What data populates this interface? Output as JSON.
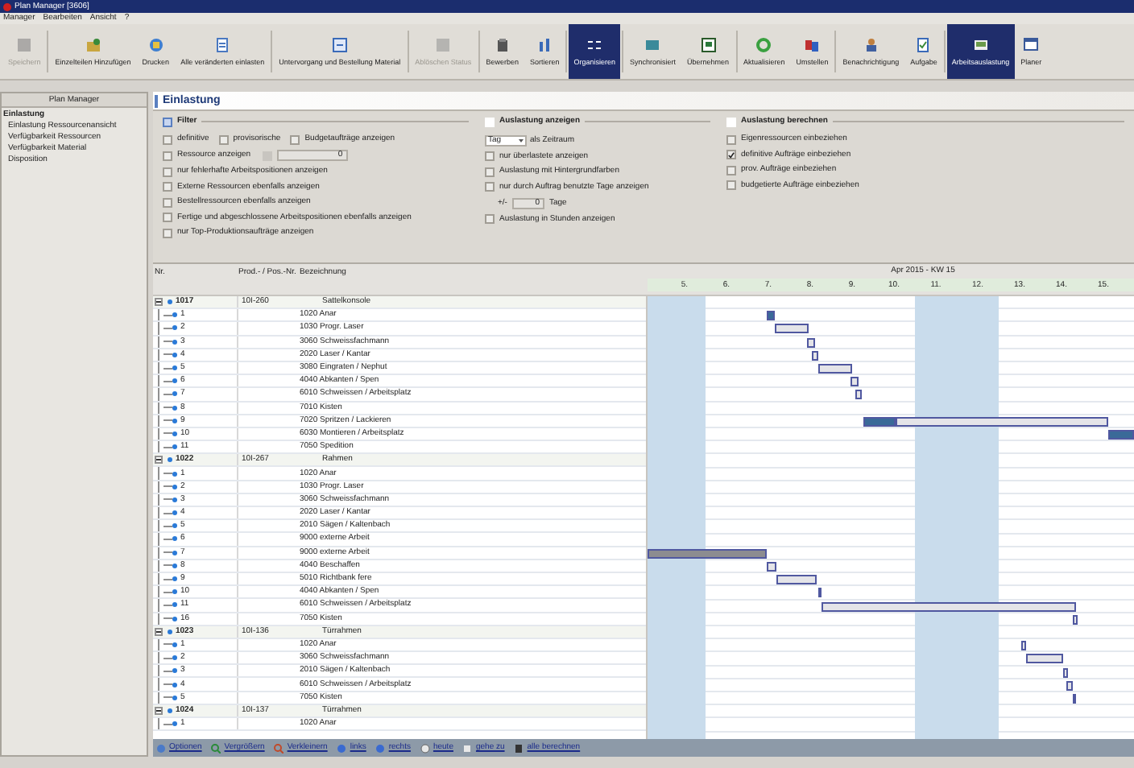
{
  "window": {
    "title": "Plan Manager [3606]"
  },
  "menu": [
    "Manager",
    "Bearbeiten",
    "Ansicht",
    "?"
  ],
  "toolbar": [
    {
      "label": "Speichern",
      "disabled": true,
      "selected": false
    },
    {
      "label": "Einzelteilen Hinzufügen",
      "disabled": false,
      "selected": false
    },
    {
      "label": "Drucken",
      "disabled": false,
      "selected": false
    },
    {
      "label": "Alle veränderten einlasten",
      "disabled": false,
      "selected": false
    },
    {
      "label": "Untervorgang und Bestellung Material",
      "disabled": false,
      "selected": false
    },
    {
      "label": "Ablöschen Status",
      "disabled": true,
      "selected": false
    },
    {
      "label": "Bewerben",
      "disabled": false,
      "selected": false
    },
    {
      "label": "Sortieren",
      "disabled": false,
      "selected": false
    },
    {
      "label": "Organisieren",
      "disabled": false,
      "selected": true
    },
    {
      "label": "Synchronisiert",
      "disabled": false,
      "selected": false
    },
    {
      "label": "Übernehmen",
      "disabled": false,
      "selected": false
    },
    {
      "label": "Aktualisieren",
      "disabled": false,
      "selected": false
    },
    {
      "label": "Umstellen",
      "disabled": false,
      "selected": false
    },
    {
      "label": "Benachrichtigung",
      "disabled": false,
      "selected": false
    },
    {
      "label": "Aufgabe",
      "disabled": false,
      "selected": false
    },
    {
      "label": "Arbeitsauslastung",
      "disabled": false,
      "selected": true
    },
    {
      "label": "Planer",
      "disabled": false,
      "selected": false
    }
  ],
  "sidebar": {
    "title": "Plan Manager",
    "items": [
      {
        "label": "Einlastung",
        "selected": true
      },
      {
        "label": "Einlastung Ressourcenansicht",
        "selected": false
      },
      {
        "label": "Verfügbarkeit Ressourcen",
        "selected": false
      },
      {
        "label": "Verfügbarkeit Material",
        "selected": false
      },
      {
        "label": "Disposition",
        "selected": false
      }
    ]
  },
  "page_title": "Einlastung",
  "filter": {
    "title": "Filter",
    "top_row": [
      {
        "label": "definitive",
        "checked": false
      },
      {
        "label": "provisorische",
        "checked": false
      },
      {
        "label": "Budgetaufträge anzeigen",
        "checked": false
      }
    ],
    "resource": {
      "label": "Ressource anzeigen",
      "checked": false,
      "value": "0"
    },
    "options": [
      {
        "label": "nur fehlerhafte Arbeitspositionen anzeigen",
        "checked": false
      },
      {
        "label": "Externe Ressourcen ebenfalls anzeigen",
        "checked": false
      },
      {
        "label": "Bestellressourcen ebenfalls anzeigen",
        "checked": false
      },
      {
        "label": "Fertige und abgeschlossene Arbeitspositionen ebenfalls anzeigen",
        "checked": false
      },
      {
        "label": "nur Top-Produktionsaufträge anzeigen",
        "checked": false
      }
    ]
  },
  "display": {
    "title": "Auslastung anzeigen",
    "checked": false,
    "period": {
      "value": "Tag",
      "label": "als Zeitraum"
    },
    "options": [
      {
        "label": "nur überlastete anzeigen",
        "checked": false
      },
      {
        "label": "Auslastung mit Hintergrundfarben",
        "checked": false
      },
      {
        "label": "nur durch Auftrag benutzte Tage anzeigen",
        "checked": false
      }
    ],
    "range": {
      "prefix": "+/-",
      "value": "0",
      "suffix": "Tage"
    },
    "hours": {
      "label": "Auslastung in Stunden anzeigen",
      "checked": false
    }
  },
  "calculate": {
    "title": "Auslastung berechnen",
    "checked": false,
    "options": [
      {
        "label": "Eigenressourcen einbeziehen",
        "checked": false
      },
      {
        "label": "definitive Aufträge einbeziehen",
        "checked": true
      },
      {
        "label": "prov. Aufträge einbeziehen",
        "checked": false
      },
      {
        "label": "budgetierte Aufträge einbeziehen",
        "checked": false
      }
    ]
  },
  "table": {
    "columns": [
      "Nr.",
      "Prod.- / Pos.-Nr.",
      "Bezeichnung"
    ],
    "week": "Apr 2015 - KW 15",
    "days": [
      {
        "label": "5.",
        "weekend": true
      },
      {
        "label": "6.",
        "weekend": false
      },
      {
        "label": "7.",
        "weekend": false
      },
      {
        "label": "8.",
        "weekend": false
      },
      {
        "label": "9.",
        "weekend": false
      },
      {
        "label": "10.",
        "weekend": false
      },
      {
        "label": "11.",
        "weekend": true
      },
      {
        "label": "12.",
        "weekend": true
      },
      {
        "label": "13.",
        "weekend": false
      },
      {
        "label": "14.",
        "weekend": false
      },
      {
        "label": "15.",
        "weekend": false
      }
    ],
    "orders": [
      {
        "nr": "1017",
        "prod": "10I-260",
        "name": "Sattelkonsole",
        "expanded": true,
        "children": [
          {
            "nr": "1",
            "name": "1020 Anar"
          },
          {
            "nr": "2",
            "name": "1030 Progr. Laser"
          },
          {
            "nr": "3",
            "name": "3060 Schweissfachmann"
          },
          {
            "nr": "4",
            "name": "2020 Laser / Kantar"
          },
          {
            "nr": "5",
            "name": "3080 Eingraten / Nephut"
          },
          {
            "nr": "6",
            "name": "4040 Abkanten / Spen"
          },
          {
            "nr": "7",
            "name": "6010 Schweissen / Arbeitsplatz"
          },
          {
            "nr": "8",
            "name": "7010 Kisten"
          },
          {
            "nr": "9",
            "name": "7020 Spritzen / Lackieren"
          },
          {
            "nr": "10",
            "name": "6030 Montieren / Arbeitsplatz"
          },
          {
            "nr": "11",
            "name": "7050 Spedition"
          }
        ]
      },
      {
        "nr": "1022",
        "prod": "10I-267",
        "name": "Rahmen",
        "expanded": true,
        "children": [
          {
            "nr": "1",
            "name": "1020 Anar"
          },
          {
            "nr": "2",
            "name": "1030 Progr. Laser"
          },
          {
            "nr": "3",
            "name": "3060 Schweissfachmann"
          },
          {
            "nr": "4",
            "name": "2020 Laser / Kantar"
          },
          {
            "nr": "5",
            "name": "2010 Sägen / Kaltenbach"
          },
          {
            "nr": "6",
            "name": "9000 externe Arbeit"
          },
          {
            "nr": "7",
            "name": "9000 externe Arbeit"
          },
          {
            "nr": "8",
            "name": "4040 Beschaffen"
          },
          {
            "nr": "9",
            "name": "5010 Richtbank fere"
          },
          {
            "nr": "10",
            "name": "4040 Abkanten / Spen"
          },
          {
            "nr": "11",
            "name": "6010 Schweissen / Arbeitsplatz"
          },
          {
            "nr": "16",
            "name": "7050 Kisten"
          }
        ]
      },
      {
        "nr": "1023",
        "prod": "10I-136",
        "name": "Türrahmen",
        "expanded": true,
        "children": [
          {
            "nr": "1",
            "name": "1020 Anar"
          },
          {
            "nr": "2",
            "name": "3060 Schweissfachmann"
          },
          {
            "nr": "3",
            "name": "2010 Sägen / Kaltenbach"
          },
          {
            "nr": "4",
            "name": "6010 Schweissen / Arbeitsplatz"
          },
          {
            "nr": "5",
            "name": "7050 Kisten"
          }
        ]
      },
      {
        "nr": "1024",
        "prod": "10I-137",
        "name": "Türrahmen",
        "expanded": true,
        "children": [
          {
            "nr": "1",
            "name": "1020 Anar"
          }
        ]
      }
    ]
  },
  "bottom_bar": [
    "Optionen",
    "Vergrößern",
    "Verkleinern",
    "links",
    "rechts",
    "heute",
    "gehe zu",
    "alle berechnen"
  ]
}
